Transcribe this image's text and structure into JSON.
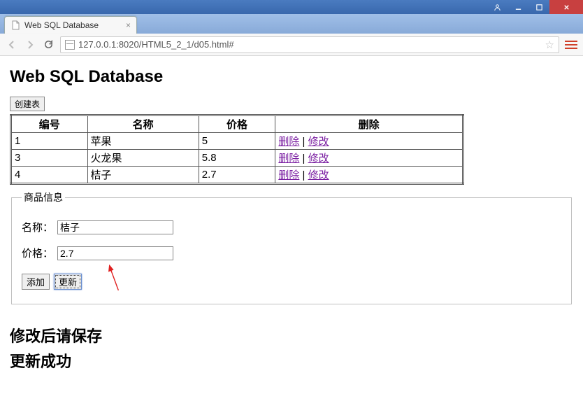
{
  "browser": {
    "tab_title": "Web SQL Database",
    "url": "127.0.0.1:8020/HTML5_2_1/d05.html#"
  },
  "page": {
    "title": "Web SQL Database",
    "create_table_btn": "创建表",
    "table": {
      "headers": [
        "编号",
        "名称",
        "价格",
        "删除"
      ],
      "rows": [
        {
          "id": "1",
          "name": "苹果",
          "price": "5"
        },
        {
          "id": "3",
          "name": "火龙果",
          "price": "5.8"
        },
        {
          "id": "4",
          "name": "桔子",
          "price": "2.7"
        }
      ],
      "delete_label": "删除",
      "edit_label": "修改"
    },
    "fieldset_legend": "商品信息",
    "form": {
      "name_label": "名称：",
      "name_value": "桔子",
      "price_label": "价格：",
      "price_value": "2.7",
      "add_btn": "添加",
      "update_btn": "更新"
    },
    "messages": {
      "line1": "修改后请保存",
      "line2": "更新成功"
    }
  }
}
